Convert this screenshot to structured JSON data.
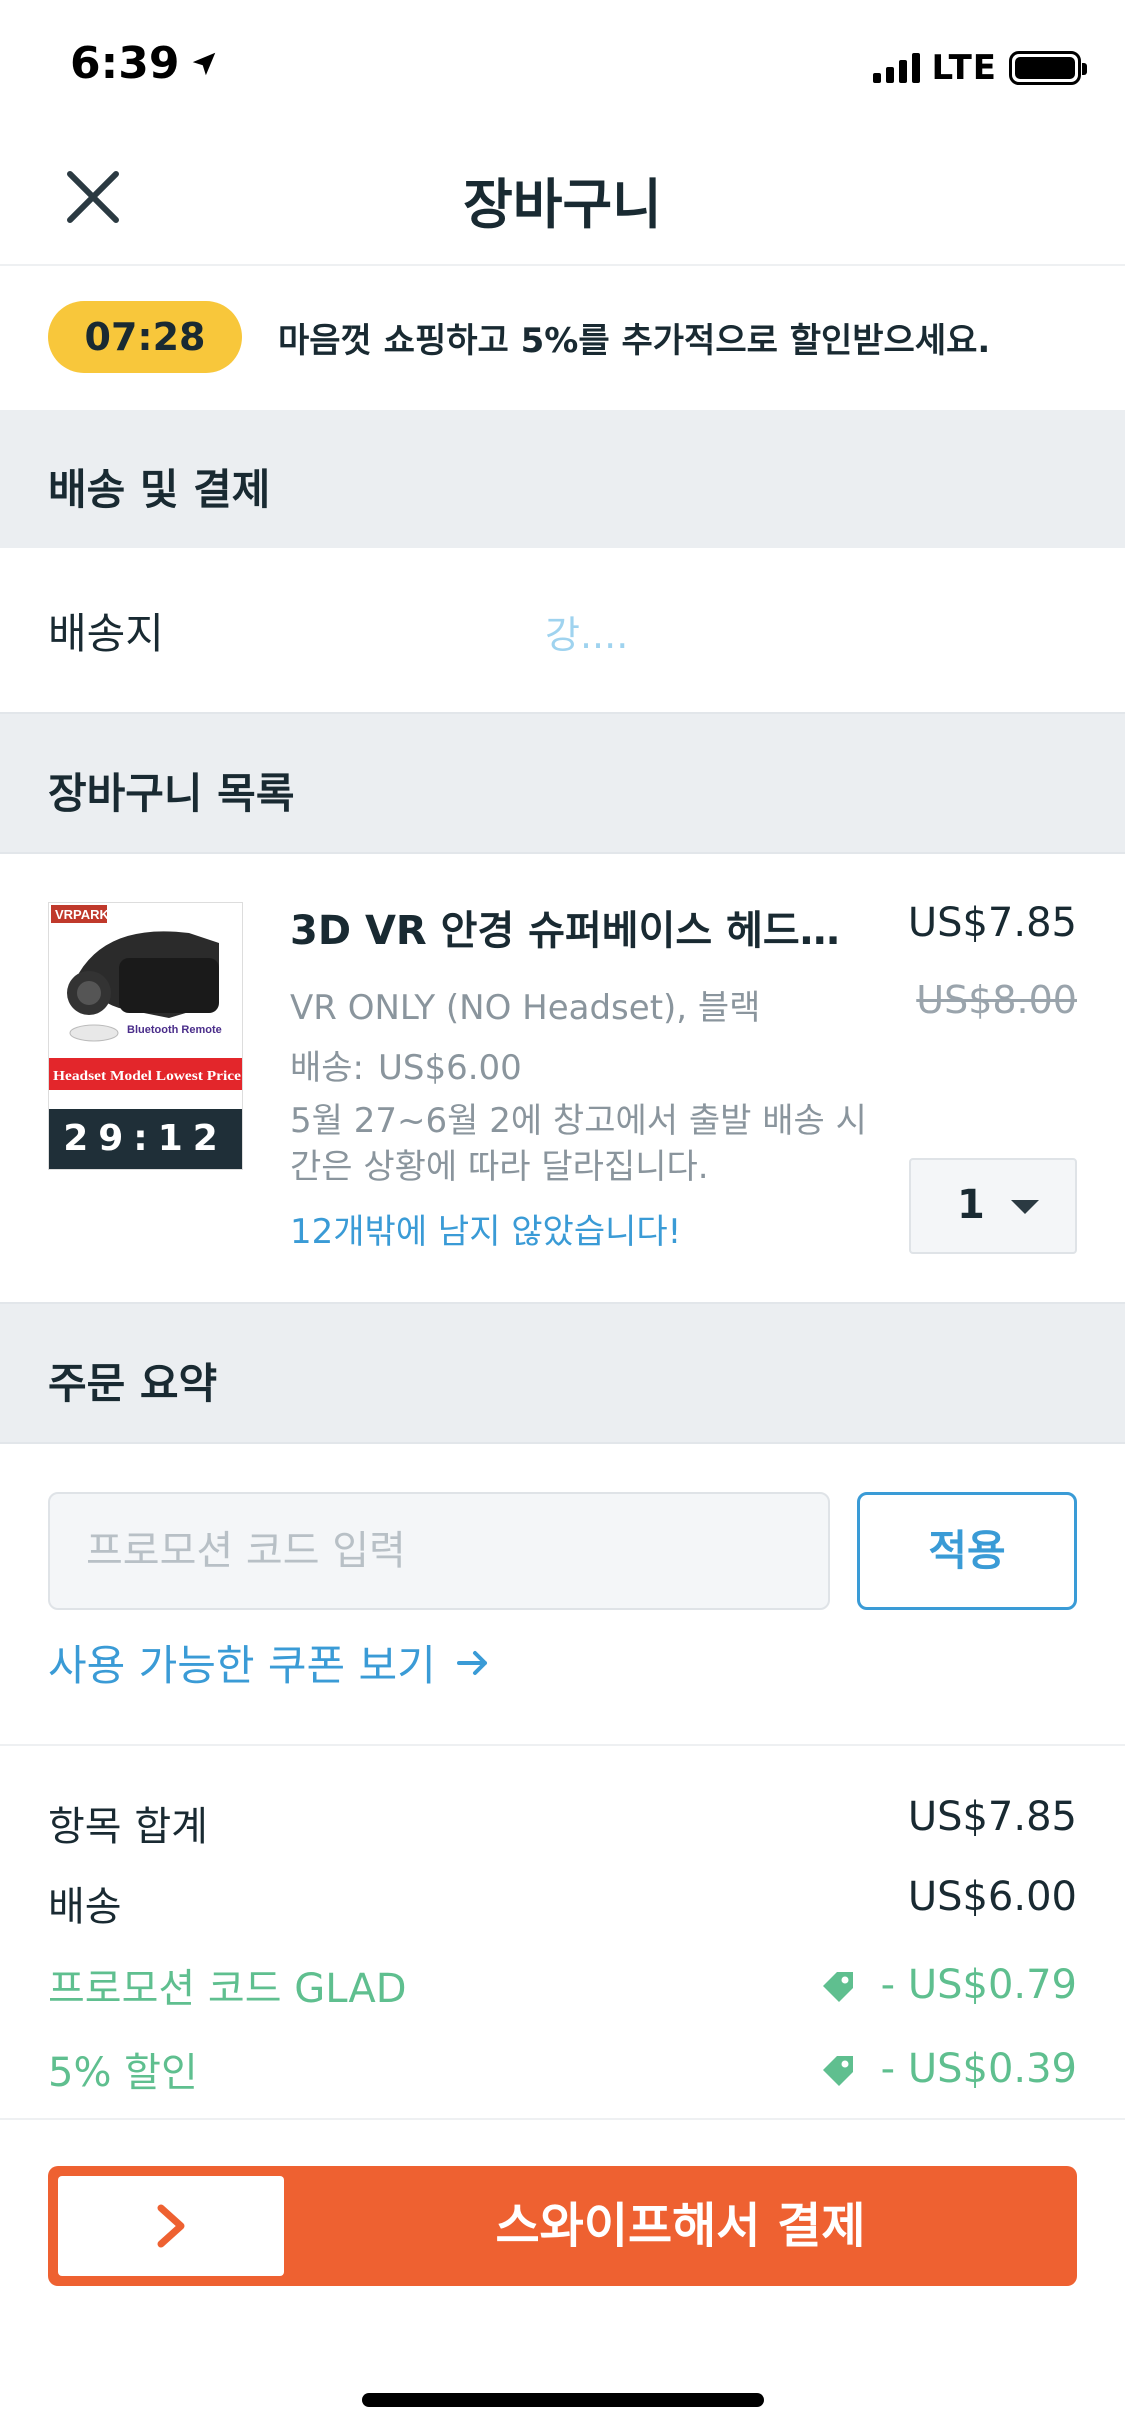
{
  "status_bar": {
    "time": "6:39",
    "network": "LTE"
  },
  "header": {
    "title": "장바구니"
  },
  "promo_banner": {
    "timer": "07:28",
    "text": "마음껏 쇼핑하고 5%를 추가적으로 할인받으세요."
  },
  "shipping_section": {
    "title": "배송 및 결제",
    "ship_to_label": "배송지",
    "ship_to_value": "강...."
  },
  "cart_section": {
    "title": "장바구니 목록",
    "item": {
      "title": "3D VR 안경 슈퍼베이스 헤드…",
      "price": "US$7.85",
      "original_price": "US$8.00",
      "variant": "VR ONLY (NO Headset), 블랙",
      "shipping_label": "배송:",
      "shipping_value": "US$6.00",
      "delivery": "5월 27~6월 2에 창고에서 출발 배송 시간은 상황에 따라 달라집니다.",
      "stock": "12개밖에 남지 않았습니다!",
      "quantity": "1",
      "image_timer": "29:12",
      "image_text": {
        "brand": "VRPARK",
        "remote": "Bluetooth Remote",
        "promo": "Headset Model Lowest Price"
      }
    }
  },
  "order_summary": {
    "title": "주문 요약",
    "promo_placeholder": "프로모션 코드 입력",
    "apply_label": "적용",
    "coupon_link": "사용 가능한 쿠폰 보기",
    "rows": [
      {
        "label": "항목 합계",
        "value": "US$7.85"
      },
      {
        "label": "배송",
        "value": "US$6.00"
      },
      {
        "label": "프로모션 코드 GLAD",
        "value": "- US$0.79"
      },
      {
        "label": "5% 할인",
        "value": "- US$0.39"
      }
    ]
  },
  "checkout": {
    "swipe_label": "스와이프해서 결제"
  },
  "colors": {
    "accent_blue": "#3a9bd6",
    "checkout_orange": "#ee6131",
    "timer_yellow": "#f8c73b",
    "discount_green": "#5fbf8f"
  }
}
